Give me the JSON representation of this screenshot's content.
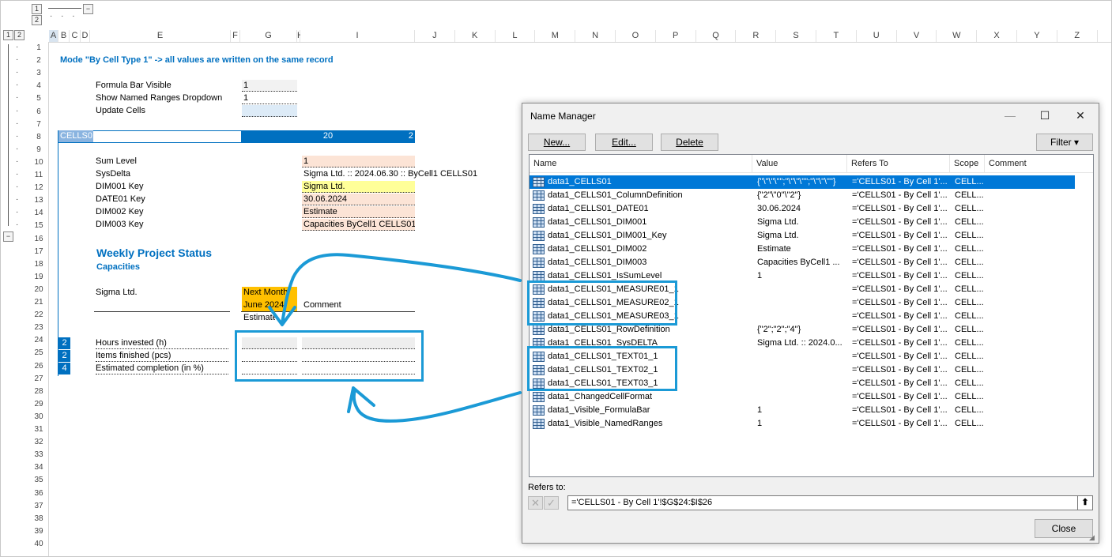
{
  "outline": {
    "levels": [
      "1",
      "2"
    ],
    "collapse": "−",
    "dots": "· · ·"
  },
  "columns": [
    "A",
    "B",
    "C",
    "D",
    "E",
    "F",
    "G",
    "H",
    "I",
    "J",
    "K",
    "L",
    "M",
    "N",
    "O",
    "P",
    "Q",
    "R",
    "S",
    "T",
    "U",
    "V",
    "W",
    "X",
    "Y",
    "Z"
  ],
  "rows": [
    "1",
    "2",
    "3",
    "4",
    "5",
    "6",
    "7",
    "8",
    "9",
    "10",
    "11",
    "12",
    "13",
    "14",
    "15",
    "16",
    "17",
    "18",
    "19",
    "20",
    "21",
    "22",
    "23",
    "24",
    "25",
    "26",
    "27",
    "28",
    "29",
    "30",
    "31",
    "32",
    "33",
    "34",
    "35",
    "36",
    "37",
    "38",
    "39",
    "40"
  ],
  "sheet": {
    "mode_text": "Mode \"By Cell Type 1\" -> all values are written on the same record",
    "formula_bar_label": "Formula Bar Visible",
    "formula_bar_value": "1",
    "named_ranges_label": "Show Named Ranges Dropdown",
    "named_ranges_value": "1",
    "update_cells_label": "Update Cells",
    "band_left": "CELLS01",
    "band_mid": "20",
    "band_right": "2",
    "sum_level_label": "Sum Level",
    "sum_level_value": "1",
    "sysdelta_label": "SysDelta",
    "sysdelta_value": "Sigma Ltd. :: 2024.06.30 :: ByCell1 CELLS01",
    "dim001_label": "DIM001 Key",
    "dim001_value": "Sigma Ltd.",
    "date01_label": "DATE01 Key",
    "date01_value": "30.06.2024",
    "dim002_label": "DIM002 Key",
    "dim002_value": "Estimate",
    "dim003_label": "DIM003 Key",
    "dim003_value": "Capacities ByCell1 CELLS01",
    "report_title": "Weekly Project Status",
    "report_subtitle": "Capacities",
    "company": "Sigma Ltd.",
    "hdr_next_month": "Next Month",
    "hdr_june": "June 2024",
    "hdr_comment": "Comment",
    "hdr_estimate": "Estimate",
    "row1_key": "2",
    "row1_label": "Hours invested (h)",
    "row2_key": "2",
    "row2_label": "Items finished (pcs)",
    "row3_key": "4",
    "row3_label": "Estimated completion (in %)"
  },
  "dialog": {
    "title": "Name Manager",
    "min": "—",
    "max": "☐",
    "close_x": "✕",
    "new_label": "New...",
    "edit_label": "Edit...",
    "delete_label": "Delete",
    "filter_label": "Filter ▾",
    "headers": {
      "name": "Name",
      "value": "Value",
      "refers": "Refers To",
      "scope": "Scope",
      "comment": "Comment"
    },
    "items": [
      {
        "name": "data1_CELLS01",
        "value": "{\"\\\"\\\"\\\"\";\"\\\"\\\"\\\"\";\"\\\"\\\"\\\"\"}",
        "refers": "='CELLS01 - By Cell 1'...",
        "scope": "CELL..."
      },
      {
        "name": "data1_CELLS01_ColumnDefinition",
        "value": "{\"2\"\\\"0\"\\\"2\"}",
        "refers": "='CELLS01 - By Cell 1'...",
        "scope": "CELL..."
      },
      {
        "name": "data1_CELLS01_DATE01",
        "value": "30.06.2024",
        "refers": "='CELLS01 - By Cell 1'...",
        "scope": "CELL..."
      },
      {
        "name": "data1_CELLS01_DIM001",
        "value": "Sigma Ltd.",
        "refers": "='CELLS01 - By Cell 1'...",
        "scope": "CELL..."
      },
      {
        "name": "data1_CELLS01_DIM001_Key",
        "value": "Sigma Ltd.",
        "refers": "='CELLS01 - By Cell 1'...",
        "scope": "CELL..."
      },
      {
        "name": "data1_CELLS01_DIM002",
        "value": "Estimate",
        "refers": "='CELLS01 - By Cell 1'...",
        "scope": "CELL..."
      },
      {
        "name": "data1_CELLS01_DIM003",
        "value": "Capacities ByCell1 ...",
        "refers": "='CELLS01 - By Cell 1'...",
        "scope": "CELL..."
      },
      {
        "name": "data1_CELLS01_IsSumLevel",
        "value": "1",
        "refers": "='CELLS01 - By Cell 1'...",
        "scope": "CELL..."
      },
      {
        "name": "data1_CELLS01_MEASURE01_1",
        "value": "",
        "refers": "='CELLS01 - By Cell 1'...",
        "scope": "CELL..."
      },
      {
        "name": "data1_CELLS01_MEASURE02_1",
        "value": "",
        "refers": "='CELLS01 - By Cell 1'...",
        "scope": "CELL..."
      },
      {
        "name": "data1_CELLS01_MEASURE03_1",
        "value": "",
        "refers": "='CELLS01 - By Cell 1'...",
        "scope": "CELL..."
      },
      {
        "name": "data1_CELLS01_RowDefinition",
        "value": "{\"2\";\"2\";\"4\"}",
        "refers": "='CELLS01 - By Cell 1'...",
        "scope": "CELL..."
      },
      {
        "name": "data1_CELLS01_SysDELTA",
        "value": "Sigma Ltd. :: 2024.0...",
        "refers": "='CELLS01 - By Cell 1'...",
        "scope": "CELL..."
      },
      {
        "name": "data1_CELLS01_TEXT01_1",
        "value": "",
        "refers": "='CELLS01 - By Cell 1'...",
        "scope": "CELL..."
      },
      {
        "name": "data1_CELLS01_TEXT02_1",
        "value": "",
        "refers": "='CELLS01 - By Cell 1'...",
        "scope": "CELL..."
      },
      {
        "name": "data1_CELLS01_TEXT03_1",
        "value": "",
        "refers": "='CELLS01 - By Cell 1'...",
        "scope": "CELL..."
      },
      {
        "name": "data1_ChangedCellFormat",
        "value": "",
        "refers": "='CELLS01 - By Cell 1'...",
        "scope": "CELL..."
      },
      {
        "name": "data1_Visible_FormulaBar",
        "value": "1",
        "refers": "='CELLS01 - By Cell 1'...",
        "scope": "CELL..."
      },
      {
        "name": "data1_Visible_NamedRanges",
        "value": "1",
        "refers": "='CELLS01 - By Cell 1'...",
        "scope": "CELL..."
      }
    ],
    "refers_to_label": "Refers to:",
    "refers_to_value": "='CELLS01 - By Cell 1'!$G$24:$I$26",
    "close_label": "Close"
  },
  "colors": {
    "accent": "#0070c0",
    "highlight": "#1b9ad6",
    "orange": "#ffc000",
    "yellow": "#ffff99",
    "peach": "#fce4d6"
  }
}
